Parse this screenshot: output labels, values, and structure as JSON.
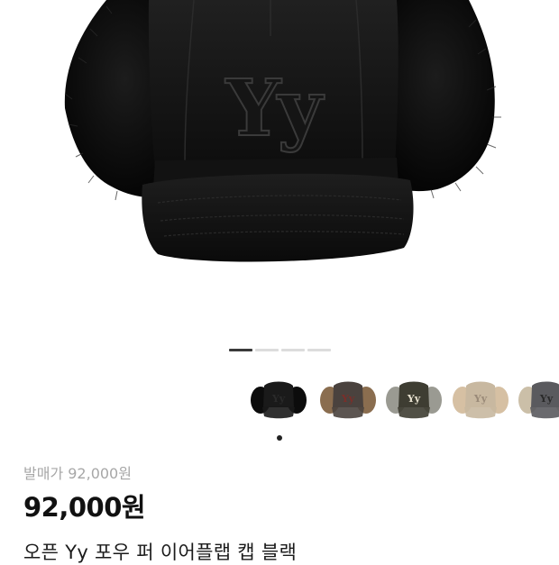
{
  "product": {
    "list_price_label": "발매가 92,000원",
    "price": "92,000원",
    "name": "오픈 Yy 포우 퍼 이어플랩 캡 블랙",
    "hero_logo_text": "Yy"
  },
  "gallery": {
    "page_count": 4,
    "active_page": 1
  },
  "color_options": [
    {
      "name": "black",
      "crown": "#1a1a1a",
      "fur": "#0c0c0c",
      "logo": "#2a2a2a"
    },
    {
      "name": "brown",
      "crown": "#4a423e",
      "fur": "#8a6d4f",
      "logo": "#7a2f2a"
    },
    {
      "name": "olive",
      "crown": "#3e3d32",
      "fur": "#9a9a92",
      "logo": "#e8e2d0"
    },
    {
      "name": "beige",
      "crown": "#c8b8a0",
      "fur": "#d6c0a3",
      "logo": "#9a8a78"
    },
    {
      "name": "grey",
      "crown": "#5a5a5e",
      "fur": "#cbbfa8",
      "logo": "#2a2a2a"
    }
  ],
  "selected_option": 0,
  "colors": {
    "price": "#111111",
    "list_price": "#a7a7a7",
    "pager_active": "#3a3a3a",
    "pager_inactive": "#dcdcdc"
  }
}
